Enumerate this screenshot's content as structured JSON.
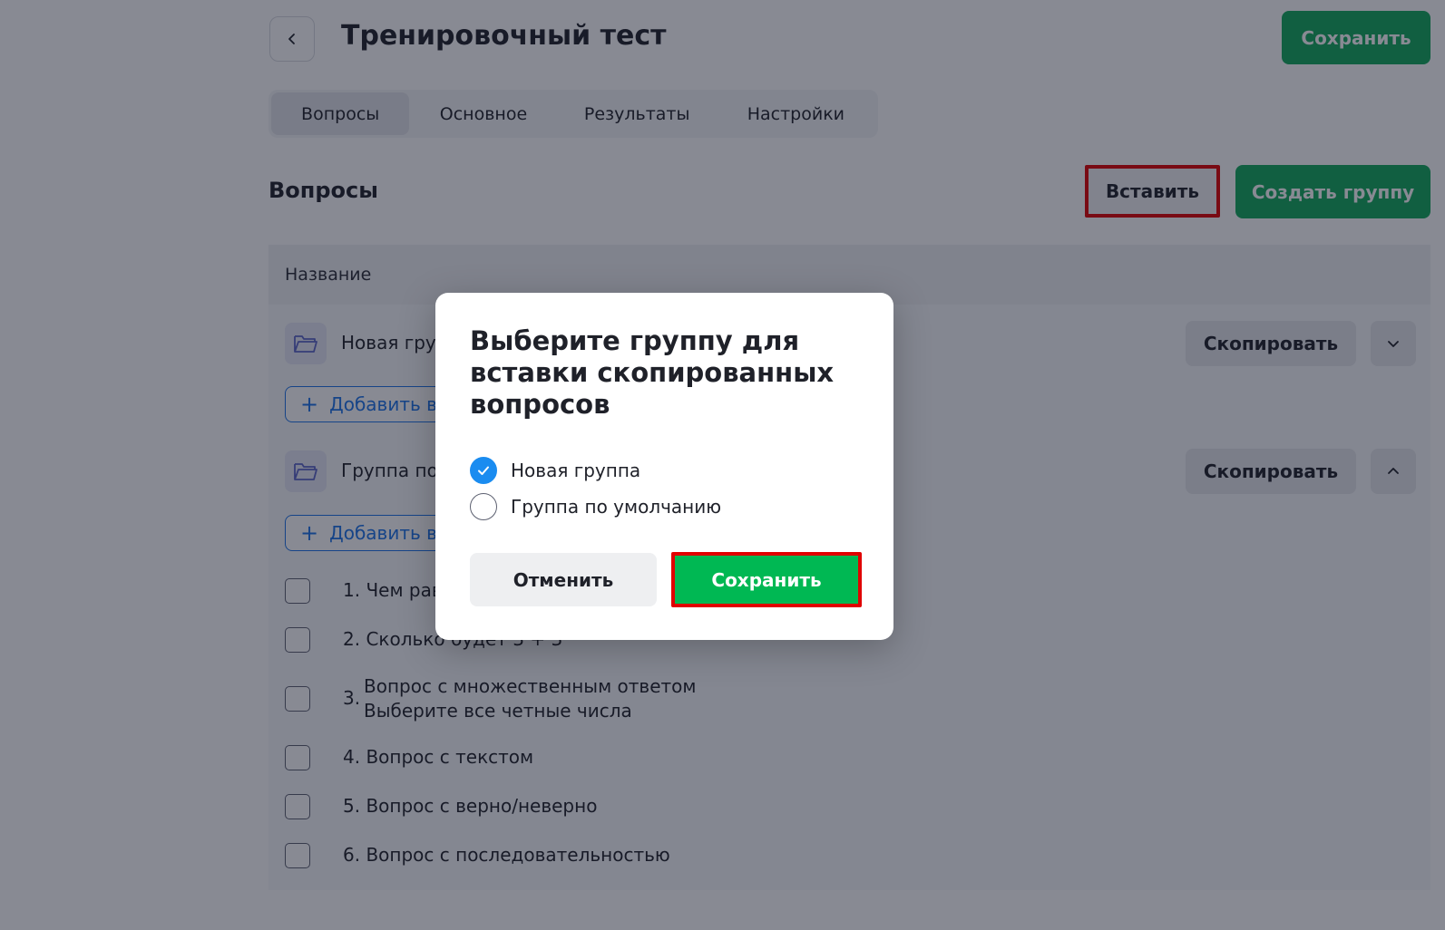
{
  "header": {
    "title": "Тренировочный тест",
    "save_label": "Сохранить"
  },
  "tabs": [
    {
      "label": "Вопросы",
      "active": true
    },
    {
      "label": "Основное",
      "active": false
    },
    {
      "label": "Результаты",
      "active": false
    },
    {
      "label": "Настройки",
      "active": false
    }
  ],
  "section": {
    "title": "Вопросы",
    "paste_label": "Вставить",
    "create_group_label": "Создать группу"
  },
  "table": {
    "column_header": "Название",
    "groups": [
      {
        "name": "Новая группа",
        "copy_label": "Скопировать",
        "add_question_label": "Добавить вопрос",
        "expanded": false
      },
      {
        "name": "Группа по умолчанию",
        "copy_label": "Скопировать",
        "add_question_label": "Добавить вопрос",
        "expanded": true
      }
    ],
    "questions": [
      {
        "text": "1. Чем равно 2 + 2"
      },
      {
        "text": "2. Сколько будет 3 + 3"
      },
      {
        "num": "3.",
        "line1": "Вопрос с множественным ответом",
        "line2": "Выберите все четные числа"
      },
      {
        "text": "4. Вопрос с текстом"
      },
      {
        "text": "5. Вопрос с верно/неверно"
      },
      {
        "text": "6. Вопрос с последовательностью"
      }
    ]
  },
  "modal": {
    "title": "Выберите группу для вставки скопированных вопросов",
    "options": [
      {
        "label": "Новая группа",
        "checked": true
      },
      {
        "label": "Группа по умолчанию",
        "checked": false
      }
    ],
    "cancel_label": "Отменить",
    "save_label": "Сохранить"
  },
  "colors": {
    "primary_green": "#10a85a",
    "modal_save_green": "#00b853",
    "highlight_red": "#e00000",
    "link_blue": "#1a73e8",
    "radio_blue": "#1a8cf0"
  }
}
